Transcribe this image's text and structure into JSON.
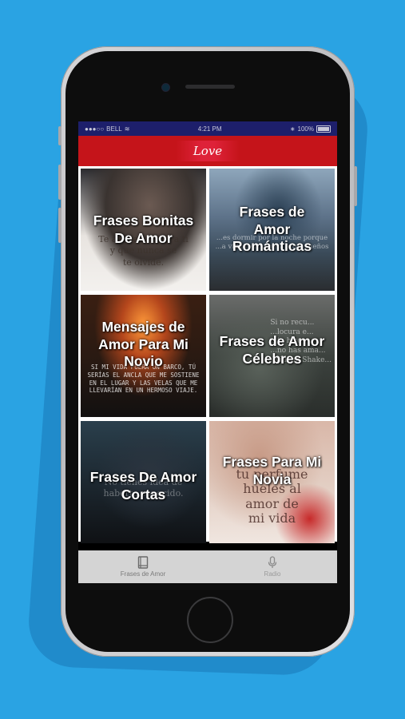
{
  "statusbar": {
    "carrier": "BELL",
    "time": "4:21 PM",
    "battery": "100%"
  },
  "appbar": {
    "title": "Love"
  },
  "tiles": [
    {
      "label": "Frases Bonitas De Amor",
      "overlay": "Te amo a ti, solo a ti\ny que nunca se\nte olvide."
    },
    {
      "label": "Frases de Amor Románticas",
      "overlay": "...es dormir por la noche porque\n...a vida real supera a tus sueños"
    },
    {
      "label": "Mensajes de Amor Para Mi Novio",
      "overlay": "SI MI VIDA FUERA UN BARCO, TÚ\nSERÍAS EL ANCLA QUE ME SOSTIENE\nEN EL LUGAR Y LAS VELAS QUE ME\nLLEVARÍAN EN UN HERMOSO VIAJE."
    },
    {
      "label": "Frases de Amor Célebres",
      "overlay": "Si no recu...\n...locura e...\n...te hizo\n...no has ama...\n-William Shake..."
    },
    {
      "label": "Frases De Amor Cortas",
      "overlay": "No tienes idea de\nhaberte conocido."
    },
    {
      "label": "Frases Para Mi Novia",
      "overlay": "tu perfume\nhueles al\namor de\nmi vida"
    }
  ],
  "tabs": [
    {
      "label": "Frases de Amor",
      "icon": "book-icon"
    },
    {
      "label": "Radio",
      "icon": "microphone-icon"
    }
  ],
  "colors": {
    "background": "#2aa3e3",
    "appbar": "#c5141a",
    "statusbar": "#1d1f6b",
    "tabbar": "#d4d4d4"
  }
}
